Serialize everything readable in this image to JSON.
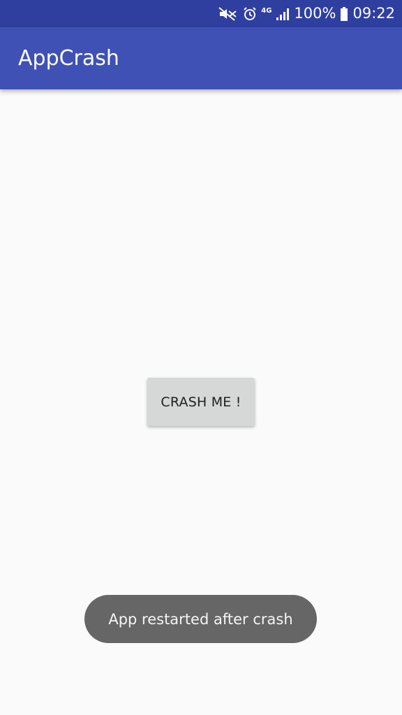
{
  "status_bar": {
    "network_type": "4G",
    "battery_percent": "100%",
    "time": "09:22",
    "icons": [
      "mute-icon",
      "alarm-icon",
      "network-4g-icon",
      "signal-icon",
      "battery-icon"
    ],
    "background_color": "#2f3f9f"
  },
  "app_bar": {
    "title": "AppCrash",
    "background_color": "#3f51b5"
  },
  "main": {
    "crash_button_label": "CRASH ME !"
  },
  "toast": {
    "message": "App restarted after crash"
  }
}
